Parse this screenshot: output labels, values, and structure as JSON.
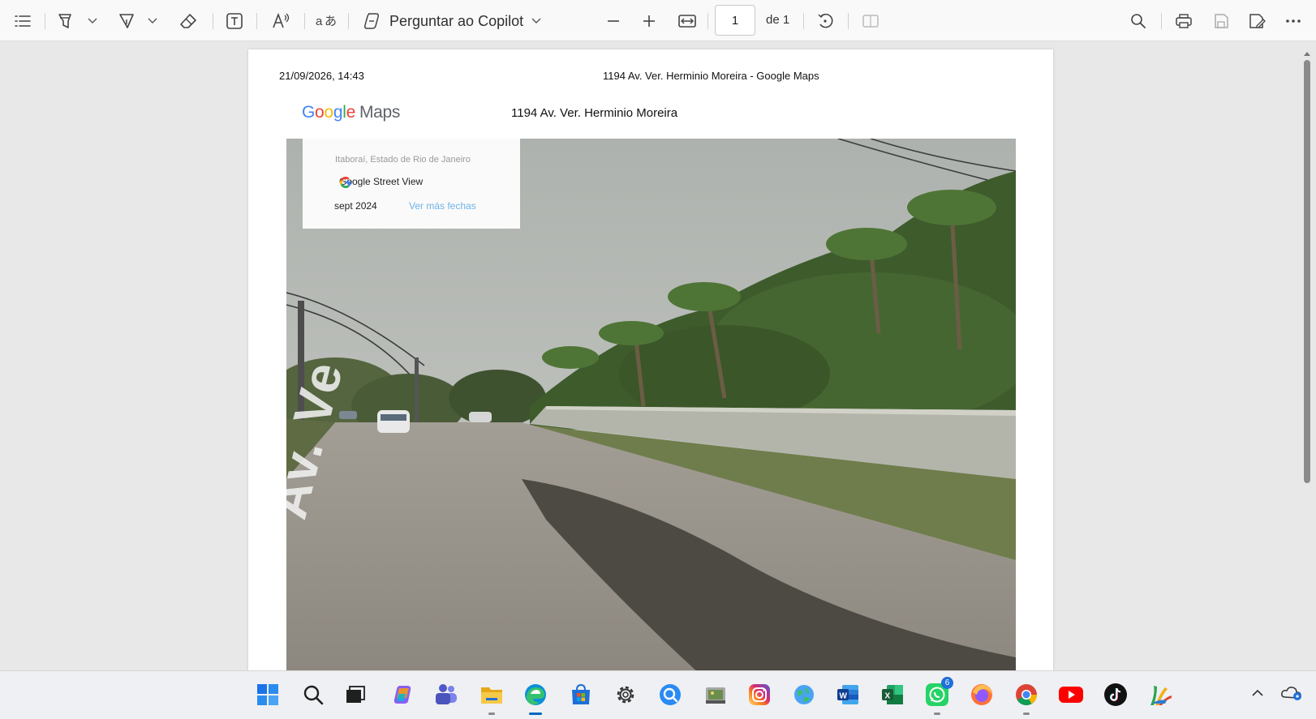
{
  "toolbar": {
    "copilot_label": "Perguntar ao Copilot",
    "page_current": "1",
    "page_of": "de 1"
  },
  "document": {
    "header_date": "21/09/2026, 14:43",
    "header_title": "1194 Av. Ver. Herminio Moreira - Google Maps",
    "logo_maps": "Maps",
    "address": "1194 Av. Ver. Herminio Moreira",
    "street_view": {
      "location": "Itaboraí, Estado de Rio de Janeiro",
      "brand": "Google Street View",
      "date": "sept 2024",
      "more_dates": "Ver más fechas"
    },
    "street_sign_text": "Av. Ver. Herminio Mo..."
  },
  "taskbar": {
    "notification_count": "6"
  },
  "colors": {
    "accent": "#0067c0",
    "google_blue": "#4285F4",
    "google_red": "#EA4335",
    "google_yellow": "#FBBC05",
    "google_green": "#34A853"
  }
}
